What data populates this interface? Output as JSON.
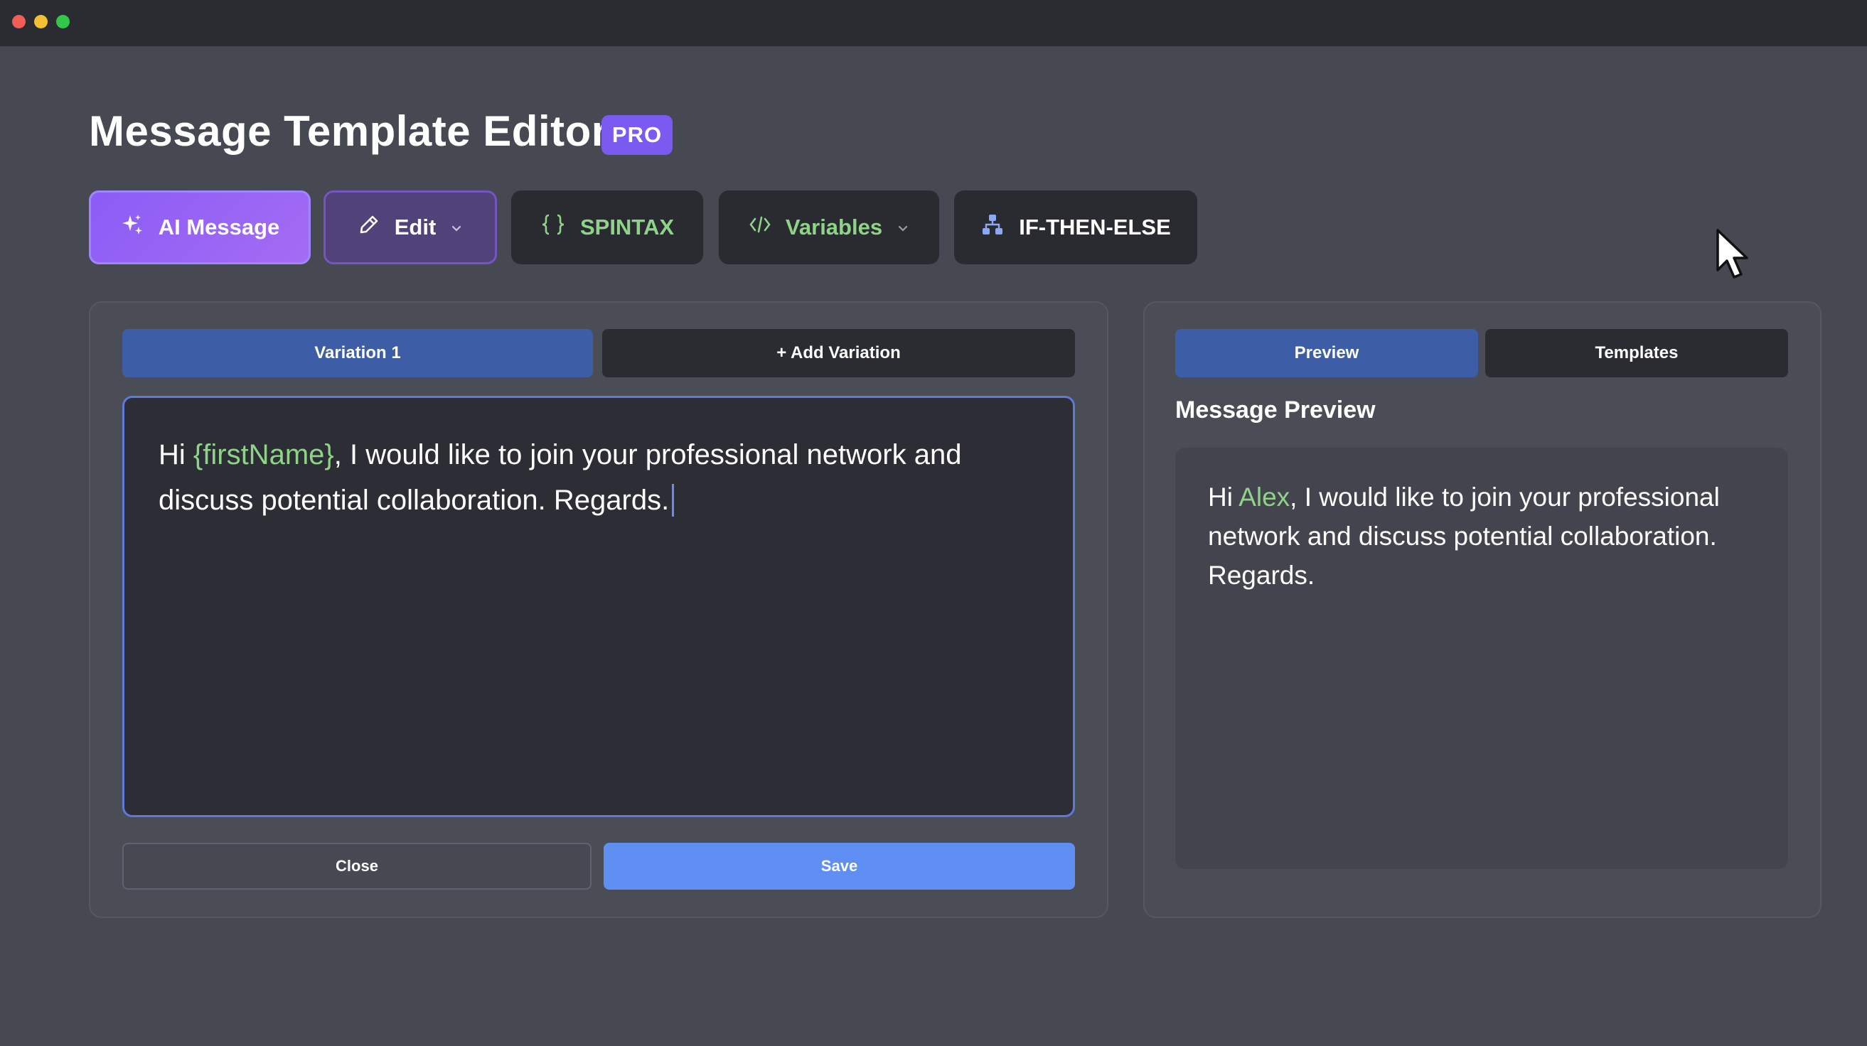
{
  "window": {
    "controls": [
      "close",
      "minimize",
      "maximize"
    ]
  },
  "header": {
    "title": "Message Template Editor",
    "badge": "PRO"
  },
  "toolbar": {
    "ai_message": {
      "label": "AI Message",
      "icon": "sparkles-icon"
    },
    "edit": {
      "label": "Edit",
      "icon": "pencil-icon"
    },
    "spintax": {
      "label": "SPINTAX",
      "icon": "braces-icon"
    },
    "variables": {
      "label": "Variables",
      "icon": "code-icon"
    },
    "if_then_else": {
      "label": "IF-THEN-ELSE",
      "icon": "branch-icon"
    }
  },
  "editor": {
    "tabs": {
      "active": "Variation 1",
      "add": "+ Add Variation"
    },
    "message": {
      "before": "Hi ",
      "variable": "{firstName}",
      "after": ", I would like to join your professional network and discuss potential collaboration. Regards."
    },
    "buttons": {
      "close": "Close",
      "save": "Save"
    }
  },
  "preview": {
    "tabs": {
      "preview": "Preview",
      "templates": "Templates"
    },
    "heading": "Message Preview",
    "message": {
      "before": "Hi ",
      "variable": "Alex",
      "after": ", I would like to join your professional network and discuss potential collaboration. Regards."
    }
  },
  "colors": {
    "background": "#464852",
    "accent_purple": "#8b5cf6",
    "accent_blue": "#5f8ff2",
    "variable_green": "#8fd389"
  }
}
